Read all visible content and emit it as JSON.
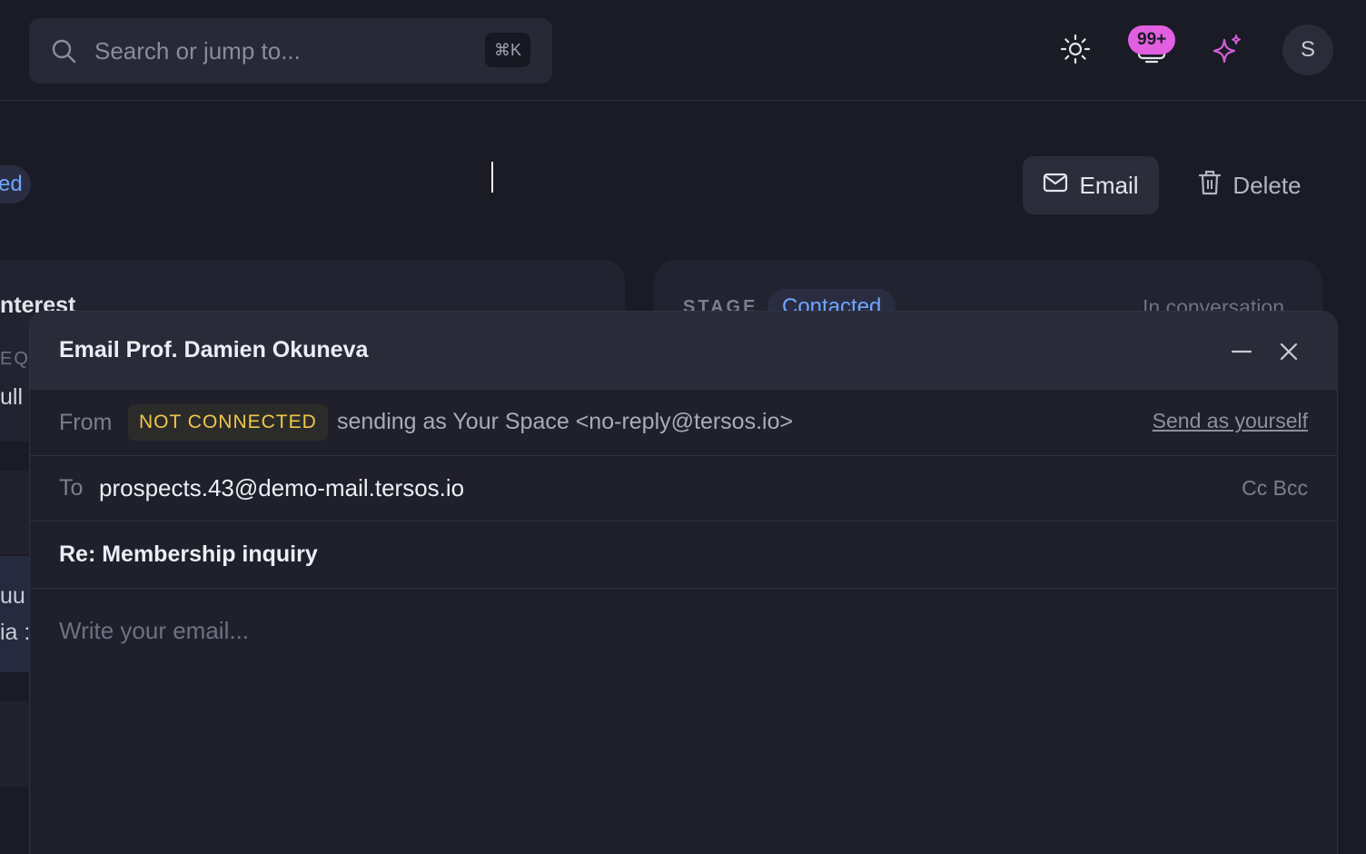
{
  "topbar": {
    "search_placeholder": "Search or jump to...",
    "search_shortcut": "⌘K",
    "notification_count": "99+",
    "avatar_initial": "S"
  },
  "page": {
    "status_pill_partial": "ed",
    "email_button": "Email",
    "delete_button": "Delete",
    "left_card_title_partial": "nterest",
    "left_card_label_partial": "EQ",
    "left_card_value_partial": "ull",
    "stage_label": "STAGE",
    "stage_value": "Contacted",
    "stage_status": "In conversation",
    "left_text_partial_1": "uu",
    "left_text_partial_2": "ia :"
  },
  "compose": {
    "title": "Email Prof. Damien Okuneva",
    "from_label": "From",
    "from_badge": "NOT CONNECTED",
    "from_sending": "sending as Your Space <no-reply@tersos.io>",
    "send_as_yourself": "Send as yourself",
    "to_label": "To",
    "to_value": "prospects.43@demo-mail.tersos.io",
    "cc_bcc": "Cc Bcc",
    "subject": "Re: Membership inquiry",
    "body_placeholder": "Write your email..."
  },
  "colors": {
    "background": "#1a1b25",
    "accent_blue": "#6ea6ff",
    "badge_pink": "#e15fe0",
    "warning_yellow": "#f1c74a"
  }
}
